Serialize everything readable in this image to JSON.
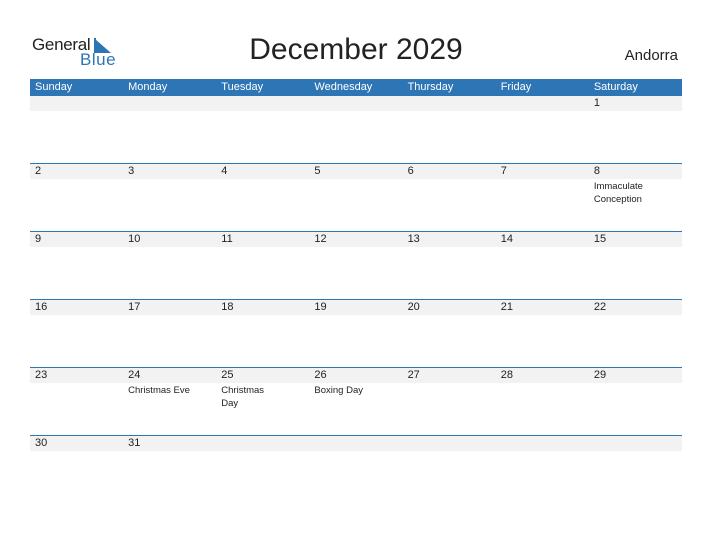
{
  "logo": {
    "general": "General",
    "blue": "Blue"
  },
  "title": "December 2029",
  "country": "Andorra",
  "colors": {
    "accent": "#2e75b6",
    "band": "#f2f2f2"
  },
  "weekdays": [
    "Sunday",
    "Monday",
    "Tuesday",
    "Wednesday",
    "Thursday",
    "Friday",
    "Saturday"
  ],
  "weeks": [
    [
      {
        "d": ""
      },
      {
        "d": ""
      },
      {
        "d": ""
      },
      {
        "d": ""
      },
      {
        "d": ""
      },
      {
        "d": ""
      },
      {
        "d": "1"
      }
    ],
    [
      {
        "d": "2"
      },
      {
        "d": "3"
      },
      {
        "d": "4"
      },
      {
        "d": "5"
      },
      {
        "d": "6"
      },
      {
        "d": "7"
      },
      {
        "d": "8",
        "h": "Immaculate Conception"
      }
    ],
    [
      {
        "d": "9"
      },
      {
        "d": "10"
      },
      {
        "d": "11"
      },
      {
        "d": "12"
      },
      {
        "d": "13"
      },
      {
        "d": "14"
      },
      {
        "d": "15"
      }
    ],
    [
      {
        "d": "16"
      },
      {
        "d": "17"
      },
      {
        "d": "18"
      },
      {
        "d": "19"
      },
      {
        "d": "20"
      },
      {
        "d": "21"
      },
      {
        "d": "22"
      }
    ],
    [
      {
        "d": "23"
      },
      {
        "d": "24",
        "h": "Christmas Eve"
      },
      {
        "d": "25",
        "h": "Christmas Day"
      },
      {
        "d": "26",
        "h": "Boxing Day"
      },
      {
        "d": "27"
      },
      {
        "d": "28"
      },
      {
        "d": "29"
      }
    ],
    [
      {
        "d": "30"
      },
      {
        "d": "31"
      },
      {
        "d": ""
      },
      {
        "d": ""
      },
      {
        "d": ""
      },
      {
        "d": ""
      },
      {
        "d": ""
      }
    ]
  ]
}
